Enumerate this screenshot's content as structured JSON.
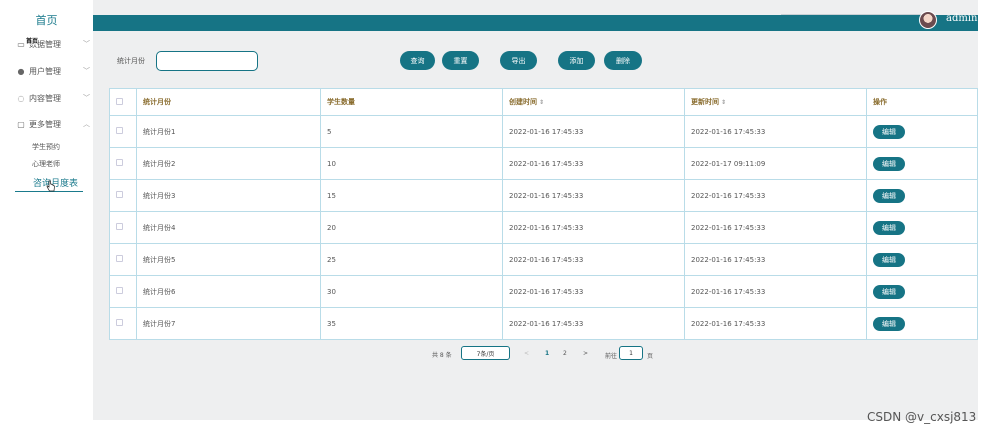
{
  "sidebar": {
    "home": "首页",
    "overlap_tip": "首页",
    "items": [
      {
        "icon": "monitor-icon",
        "label": "数据管理",
        "arrow": "﹀"
      },
      {
        "icon": "user-icon",
        "label": "用户管理",
        "arrow": "﹀"
      },
      {
        "icon": "comment-icon",
        "label": "内容管理",
        "arrow": "﹀"
      },
      {
        "icon": "folder-icon",
        "label": "更多管理",
        "arrow": "︿"
      }
    ],
    "sub_items": [
      "学生预约",
      "心理老师"
    ],
    "active_sub": "咨询月度表"
  },
  "header": {
    "username": "admin"
  },
  "search": {
    "label": "统计月份",
    "value": "",
    "placeholder": ""
  },
  "toolbar": {
    "query": "查询",
    "reset": "重置",
    "export": "导出",
    "add": "添加",
    "delete": "删除"
  },
  "table": {
    "headers": {
      "month": "统计月份",
      "count": "学生数量",
      "created": "创建时间",
      "updated": "更新时间",
      "ops": "操作"
    },
    "sort_glyph": "⇕",
    "edit_label": "编辑",
    "rows": [
      {
        "month": "统计月份1",
        "count": "5",
        "created": "2022-01-16 17:45:33",
        "updated": "2022-01-16 17:45:33"
      },
      {
        "month": "统计月份2",
        "count": "10",
        "created": "2022-01-16 17:45:33",
        "updated": "2022-01-17 09:11:09"
      },
      {
        "month": "统计月份3",
        "count": "15",
        "created": "2022-01-16 17:45:33",
        "updated": "2022-01-16 17:45:33"
      },
      {
        "month": "统计月份4",
        "count": "20",
        "created": "2022-01-16 17:45:33",
        "updated": "2022-01-16 17:45:33"
      },
      {
        "month": "统计月份5",
        "count": "25",
        "created": "2022-01-16 17:45:33",
        "updated": "2022-01-16 17:45:33"
      },
      {
        "month": "统计月份6",
        "count": "30",
        "created": "2022-01-16 17:45:33",
        "updated": "2022-01-16 17:45:33"
      },
      {
        "month": "统计月份7",
        "count": "35",
        "created": "2022-01-16 17:45:33",
        "updated": "2022-01-16 17:45:33"
      }
    ]
  },
  "pagination": {
    "total": "共 8 条",
    "page_size": "7条/页",
    "prev": "<",
    "pages": [
      "1",
      "2"
    ],
    "next": ">",
    "goto_prefix": "前往",
    "goto_value": "1",
    "goto_suffix": "页"
  },
  "watermark": "CSDN @v_cxsj813",
  "colors": {
    "accent": "#167485",
    "header_text": "#8a6d2f",
    "table_border": "#b9dce8"
  }
}
